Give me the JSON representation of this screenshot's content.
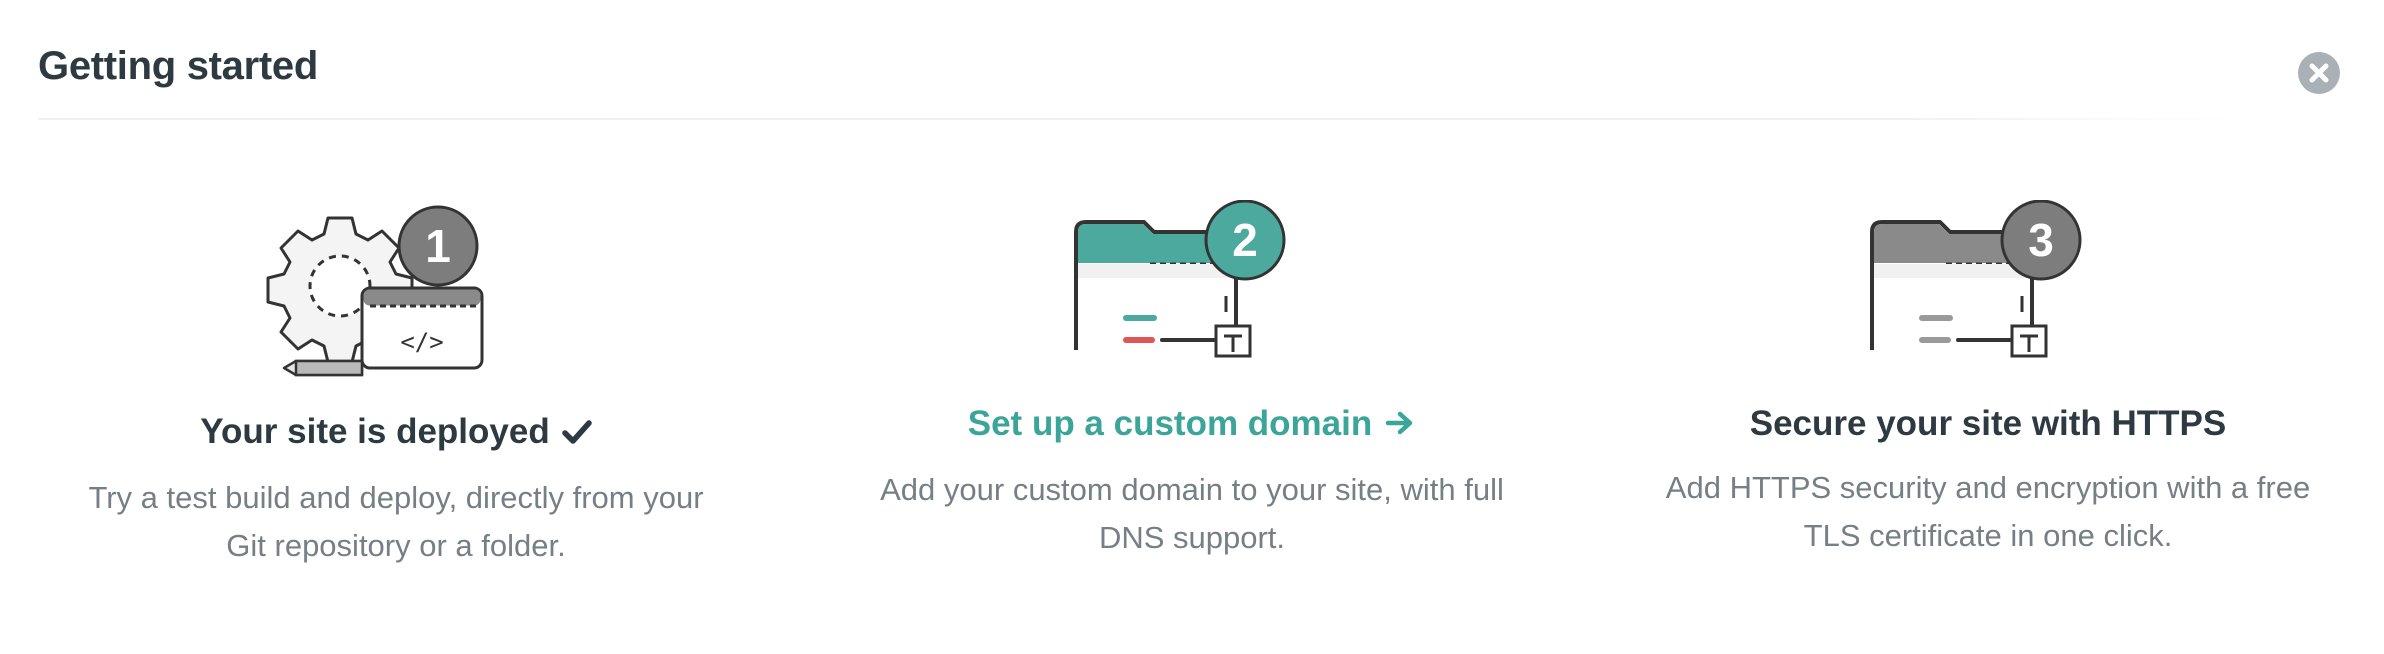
{
  "header": {
    "title": "Getting started"
  },
  "close": {
    "icon": "close-icon"
  },
  "steps": [
    {
      "number": "1",
      "title": "Your site is deployed",
      "trailing_icon": "check-icon",
      "description_lines": [
        "Try a test build and deploy, directly from your",
        "Git repository or a folder."
      ],
      "status": "completed"
    },
    {
      "number": "2",
      "title": "Set up a custom domain",
      "trailing_icon": "arrow-right-icon",
      "description_lines": [
        "Add your custom domain to your site, with full",
        "DNS support."
      ],
      "status": "active"
    },
    {
      "number": "3",
      "title": "Secure your site with HTTPS",
      "trailing_icon": "",
      "description_lines": [
        "Add HTTPS security and encryption with a free",
        "TLS certificate in one click."
      ],
      "status": "pending"
    }
  ],
  "colors": {
    "accent": "#3aa598",
    "accent_badge": "#4ba99d",
    "text_dark": "#2e3a41",
    "text_muted": "#767f86",
    "badge_gray": "#7d7d7d",
    "close_gray": "#a9b1b6"
  }
}
